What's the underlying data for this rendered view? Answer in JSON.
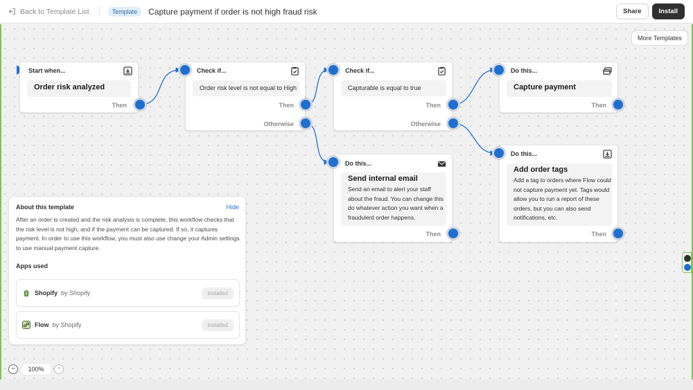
{
  "header": {
    "back_label": "Back to Template List",
    "badge": "Template",
    "title": "Capture payment if order is not high fraud risk",
    "share_label": "Share",
    "install_label": "Install"
  },
  "canvas": {
    "more_templates_label": "More Templates"
  },
  "nodes": {
    "trigger": {
      "head": "Start when...",
      "body": "Order risk analyzed",
      "then": "Then"
    },
    "check1": {
      "head": "Check if...",
      "body": "Order risk level is not equal to High",
      "then": "Then",
      "otherwise": "Otherwise"
    },
    "check2": {
      "head": "Check if...",
      "body": "Capturable is equal to true",
      "then": "Then",
      "otherwise": "Otherwise"
    },
    "capture": {
      "head": "Do this...",
      "body": "Capture payment",
      "then": "Then"
    },
    "email": {
      "head": "Do this...",
      "body": "Send internal email",
      "desc": "Send an email to alert your staff about the fraud. You can change this do whatever action you want when a fraudulent order happens.",
      "then": "Then"
    },
    "tags": {
      "head": "Do this...",
      "body": "Add order tags",
      "desc": "Add a tag to orders where Flow could not capture payment yet. Tags would allow you to run a report of these orders, but you can also send notifications, etc.",
      "then": "Then"
    }
  },
  "about": {
    "title": "About this template",
    "hide_label": "Hide",
    "text": "After an order is created and the risk analysis is complete, this workflow checks that the risk level is not high, and if the payment can be captured. If so, it captures payment. In order to use this workflow, you must also use change your Admin settings to use manual payment capture.",
    "apps_title": "Apps used",
    "apps": [
      {
        "name": "Shopify",
        "by": "by Shopify",
        "status": "Installed",
        "icon": "shopify-bag-icon"
      },
      {
        "name": "Flow",
        "by": "by Shopify",
        "status": "Installed",
        "icon": "flow-icon"
      }
    ]
  },
  "zoom": {
    "value": "100%",
    "minus": "−",
    "plus": "+"
  },
  "colors": {
    "accent": "#1f6fd1",
    "primary_button": "#303030",
    "edge": "#7ec352"
  }
}
